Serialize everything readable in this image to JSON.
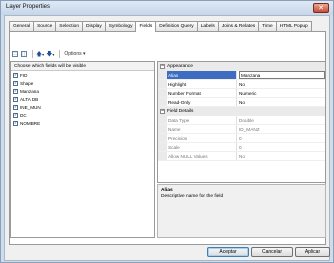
{
  "window": {
    "title": "Layer Properties",
    "close_glyph": "✕"
  },
  "tabs": [
    {
      "label": "General"
    },
    {
      "label": "Source"
    },
    {
      "label": "Selection"
    },
    {
      "label": "Display"
    },
    {
      "label": "Symbology"
    },
    {
      "label": "Fields"
    },
    {
      "label": "Definition Query"
    },
    {
      "label": "Labels"
    },
    {
      "label": "Joins & Relates"
    },
    {
      "label": "Time"
    },
    {
      "label": "HTML Popup"
    }
  ],
  "active_tab": "Fields",
  "toolbar": {
    "up_glyph": "🡅",
    "down_glyph": "🡇",
    "dropdown_glyph": "▾",
    "options_label": "Options ▾"
  },
  "fields_list": {
    "header": "Choose which fields will be visible",
    "items": [
      {
        "label": "FID",
        "checked": true
      },
      {
        "label": "Shape",
        "checked": true
      },
      {
        "label": "Manzana",
        "checked": true
      },
      {
        "label": "ALTA DB",
        "checked": true
      },
      {
        "label": "INE_MUN",
        "checked": true
      },
      {
        "label": "DC",
        "checked": true
      },
      {
        "label": "NOMBRE",
        "checked": true
      }
    ],
    "check_glyph": "✓"
  },
  "appearance": {
    "category": "Appearance",
    "toggle": "−",
    "rows": [
      {
        "name": "Alias",
        "value": "Manzana"
      },
      {
        "name": "Highlight",
        "value": "No"
      },
      {
        "name": "Number Format",
        "value": "Numeric"
      },
      {
        "name": "Read-Only",
        "value": "No"
      }
    ]
  },
  "field_details": {
    "category": "Field Details",
    "toggle": "−",
    "rows": [
      {
        "name": "Data Type",
        "value": "Double"
      },
      {
        "name": "Name",
        "value": "ID_MANZ"
      },
      {
        "name": "Precision",
        "value": "0"
      },
      {
        "name": "Scale",
        "value": "0"
      },
      {
        "name": "Allow NULL Values",
        "value": "No"
      }
    ]
  },
  "description": {
    "title": "Alias",
    "text": "Descriptive name for the field"
  },
  "buttons": {
    "accept": "Aceptar",
    "cancel": "Cancelar",
    "apply": "Aplicar"
  }
}
